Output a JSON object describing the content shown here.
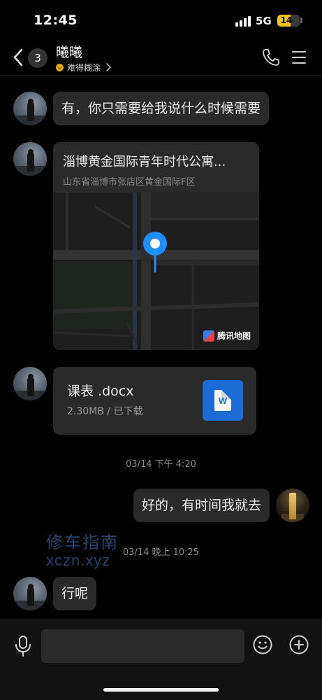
{
  "status_bar": {
    "time": "12:45",
    "network": "5G",
    "battery_level": "14",
    "battery_color": "#f5c318"
  },
  "header": {
    "back_icon": "chevron-left-icon",
    "unread_count": "3",
    "contact_name": "曦曦",
    "status_text": "难得糊涂",
    "call_icon": "phone-icon",
    "menu_icon": "menu-icon"
  },
  "messages": [
    {
      "type": "text",
      "from": "contact",
      "text": "有，你只需要给我说什么时候需要"
    },
    {
      "type": "location",
      "from": "contact",
      "title": "淄博黄金国际青年时代公寓...",
      "address": "山东省淄博市张店区黄金国际F区",
      "map_provider": "腾讯地图",
      "pin_color": "#1e8fff"
    },
    {
      "type": "file",
      "from": "contact",
      "name": "课表 .docx",
      "meta": "2.30MB / 已下载",
      "icon_letter": "W",
      "icon_color": "#1c6cd6"
    },
    {
      "type": "timestamp",
      "text": "03/14 下午 4:20"
    },
    {
      "type": "text",
      "from": "me",
      "text": "好的，有时间我就去"
    },
    {
      "type": "timestamp",
      "text": "03/14 晚上 10:25"
    },
    {
      "type": "text",
      "from": "contact",
      "text": "行呢"
    }
  ],
  "watermark": {
    "line1": "修车指南",
    "line2": "xczn.xyz"
  },
  "input_bar": {
    "placeholder": "",
    "voice_icon": "microphone-icon",
    "emoji_icon": "smiley-icon",
    "more_icon": "plus-circle-icon"
  }
}
